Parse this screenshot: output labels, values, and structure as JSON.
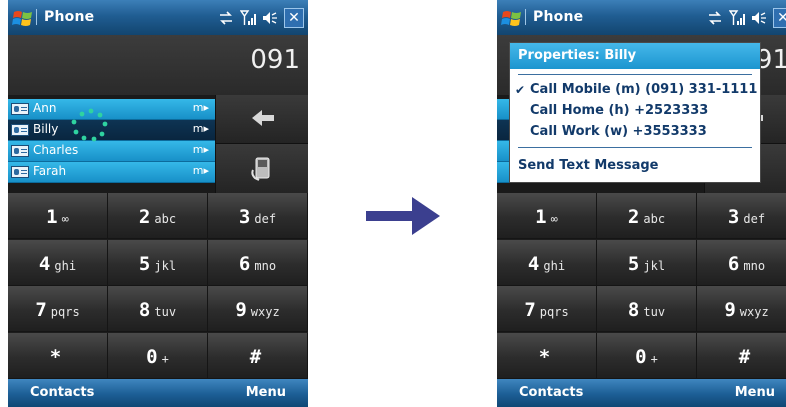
{
  "app_title": "Phone",
  "dialed_number": "091",
  "softkeys": {
    "left": "Contacts",
    "right": "Menu"
  },
  "contacts": [
    {
      "name": "Ann",
      "tag": "m▸"
    },
    {
      "name": "Billy",
      "tag": "m▸"
    },
    {
      "name": "Charles",
      "tag": "m▸"
    },
    {
      "name": "Farah",
      "tag": "m▸"
    }
  ],
  "keys": [
    {
      "num": "1",
      "letters": "∞"
    },
    {
      "num": "2",
      "letters": "abc"
    },
    {
      "num": "3",
      "letters": "def"
    },
    {
      "num": "4",
      "letters": "ghi"
    },
    {
      "num": "5",
      "letters": "jkl"
    },
    {
      "num": "6",
      "letters": "mno"
    },
    {
      "num": "7",
      "letters": "pqrs"
    },
    {
      "num": "8",
      "letters": "tuv"
    },
    {
      "num": "9",
      "letters": "wxyz"
    },
    {
      "num": "*",
      "letters": ""
    },
    {
      "num": "0",
      "letters": "+"
    },
    {
      "num": "#",
      "letters": ""
    }
  ],
  "popup": {
    "header": "Properties: Billy",
    "items": [
      "Call Mobile (m) (091) 331-1111",
      "Call Home (h) +2523333",
      "Call Work (w) +3553333"
    ],
    "checked_item": "✔",
    "send_text": "Send Text Message"
  },
  "colors": {
    "titlebar": "#205d92",
    "contact_row": "#1890c8",
    "contact_selected": "#0e3454",
    "arrow": "#3b3f8f",
    "popup_text": "#123a6a"
  }
}
